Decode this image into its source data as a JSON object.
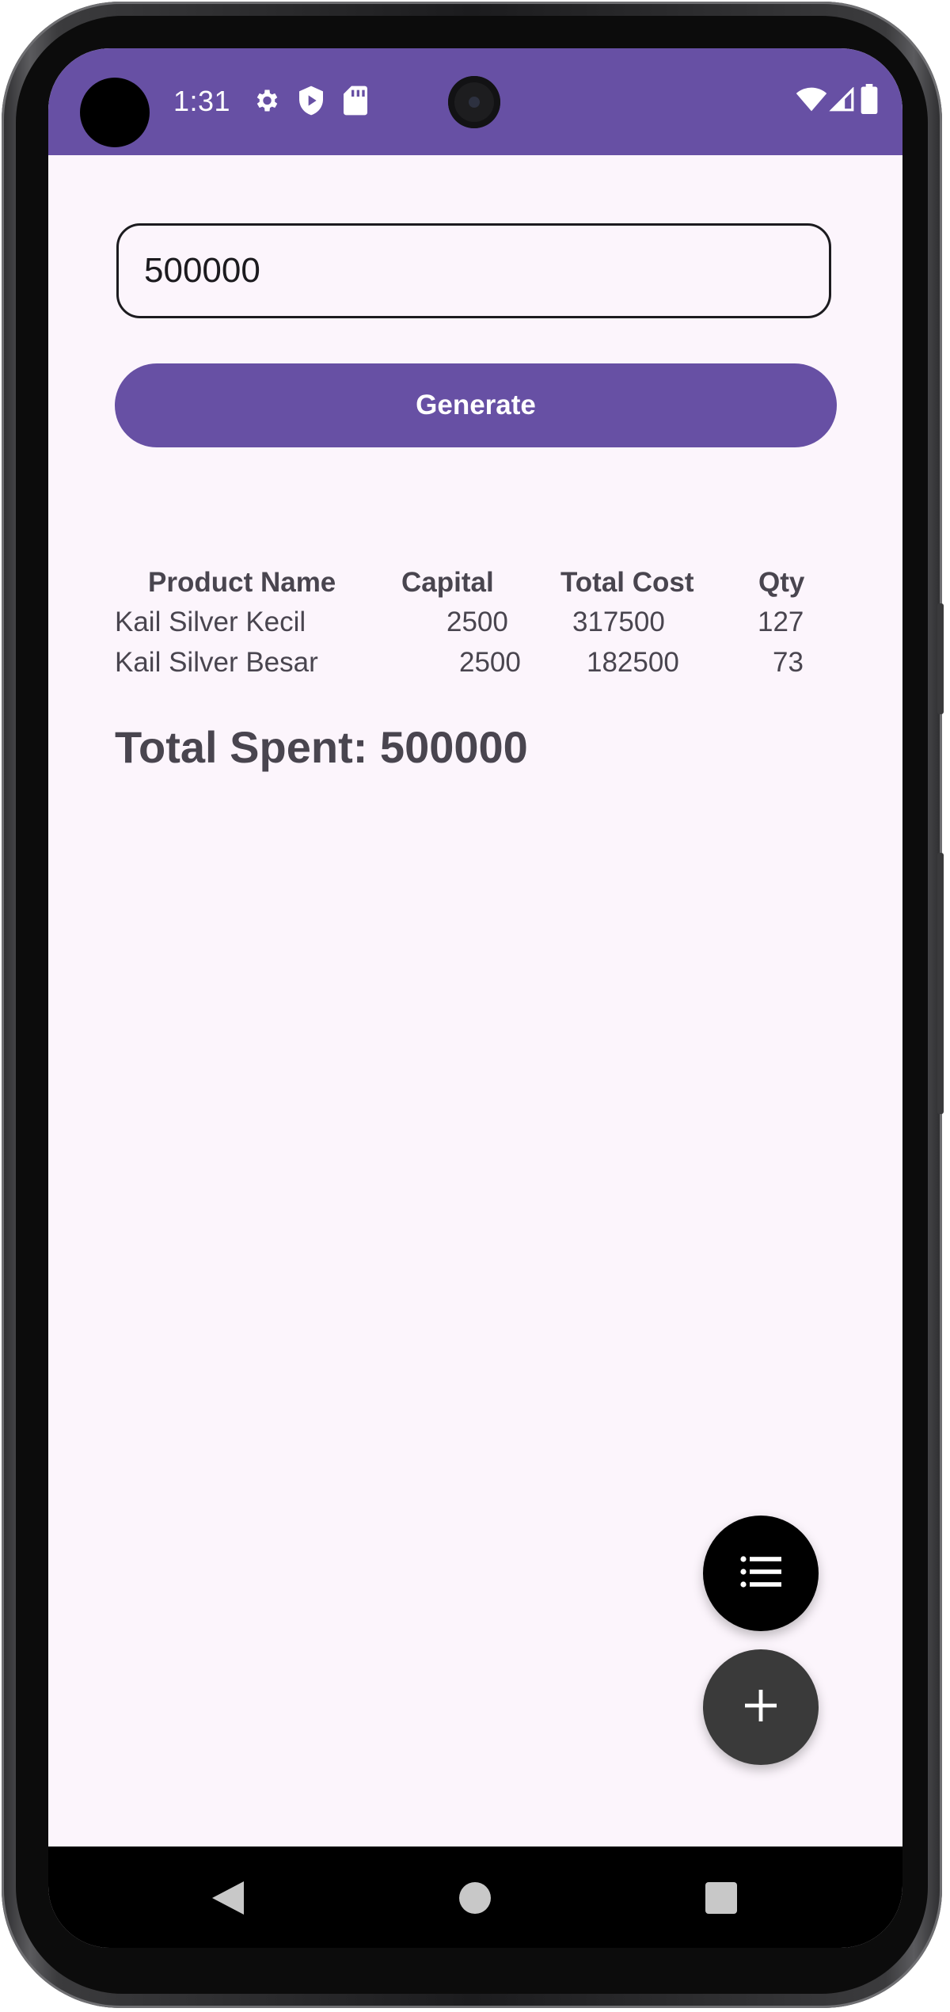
{
  "status_bar": {
    "time": "1:31",
    "icons": [
      "settings-icon",
      "shield-play-icon",
      "sd-card-icon",
      "wifi-icon",
      "signal-icon",
      "battery-icon"
    ],
    "background_color": "#6750a4"
  },
  "form": {
    "amount_value": "500000",
    "generate_label": "Generate"
  },
  "table": {
    "headers": {
      "product_name": "Product Name",
      "capital": "Capital",
      "total_cost": "Total Cost",
      "qty": "Qty"
    },
    "rows": [
      {
        "product_name": "Kail Silver Kecil",
        "capital": "2500",
        "total_cost": "317500",
        "qty": "127"
      },
      {
        "product_name": "Kail Silver Besar",
        "capital": "2500",
        "total_cost": "182500",
        "qty": "73"
      }
    ]
  },
  "summary": {
    "total_spent": "Total Spent: 500000"
  },
  "fabs": {
    "list_icon": "list-icon",
    "add_icon": "plus-icon"
  },
  "navigation": {
    "back_icon": "back-triangle-icon",
    "home_icon": "home-circle-icon",
    "recents_icon": "recents-square-icon"
  },
  "colors": {
    "primary": "#6750a4",
    "surface": "#fcf5fc",
    "text": "#49454f"
  }
}
